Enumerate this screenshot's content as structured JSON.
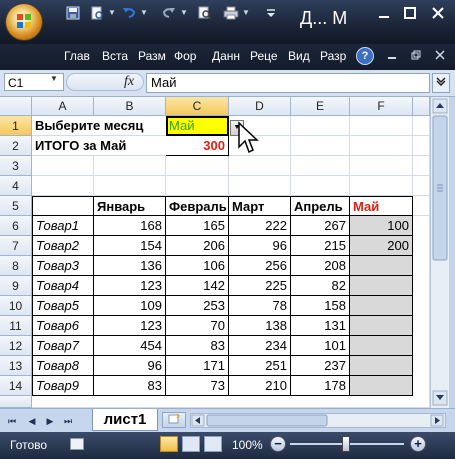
{
  "titlebar": {
    "title": "Д... М",
    "quick_access": [
      "save-icon",
      "print-preview-icon",
      "undo-icon",
      "redo-icon",
      "find-icon",
      "print-icon",
      "customize-icon"
    ],
    "window_buttons": [
      "minimize-icon",
      "maximize-icon",
      "close-icon"
    ]
  },
  "ribbon": {
    "tabs": [
      "Глав",
      "Вста",
      "Разм",
      "Фор",
      "Данн",
      "Реце",
      "Вид",
      "Разр"
    ]
  },
  "formula_bar": {
    "name_box": "C1",
    "fx_label": "fx",
    "formula": "Май"
  },
  "columns": [
    "A",
    "B",
    "C",
    "D",
    "E",
    "F"
  ],
  "rows": [
    "1",
    "2",
    "3",
    "4",
    "5",
    "6",
    "7",
    "8",
    "9",
    "10",
    "11",
    "12",
    "13",
    "14",
    "15"
  ],
  "cells": {
    "A1": "Выберите месяц",
    "C1": "Май",
    "A2": "ИТОГО за Май",
    "C2": "300",
    "B5": "Январь",
    "C5": "Февраль",
    "D5": "Март",
    "E5": "Апрель",
    "F5": "Май"
  },
  "table": [
    {
      "name": "Товар1",
      "values": [
        "168",
        "165",
        "222",
        "267",
        "100"
      ]
    },
    {
      "name": "Товар2",
      "values": [
        "154",
        "206",
        "96",
        "215",
        "200"
      ]
    },
    {
      "name": "Товар3",
      "values": [
        "136",
        "106",
        "256",
        "208",
        ""
      ]
    },
    {
      "name": "Товар4",
      "values": [
        "123",
        "142",
        "225",
        "82",
        ""
      ]
    },
    {
      "name": "Товар5",
      "values": [
        "109",
        "253",
        "78",
        "158",
        ""
      ]
    },
    {
      "name": "Товар6",
      "values": [
        "123",
        "70",
        "138",
        "131",
        ""
      ]
    },
    {
      "name": "Товар7",
      "values": [
        "454",
        "83",
        "234",
        "101",
        ""
      ]
    },
    {
      "name": "Товар8",
      "values": [
        "96",
        "171",
        "251",
        "237",
        ""
      ]
    },
    {
      "name": "Товар9",
      "values": [
        "83",
        "73",
        "210",
        "178",
        ""
      ]
    }
  ],
  "sheet": {
    "tab_label": "лист1"
  },
  "statusbar": {
    "status": "Готово",
    "zoom": "100%"
  },
  "colors": {
    "accent_red": "#e02010",
    "selected_fill": "#ffff00",
    "selected_text": "#3aa000",
    "header_selected": "#f5c85a"
  }
}
